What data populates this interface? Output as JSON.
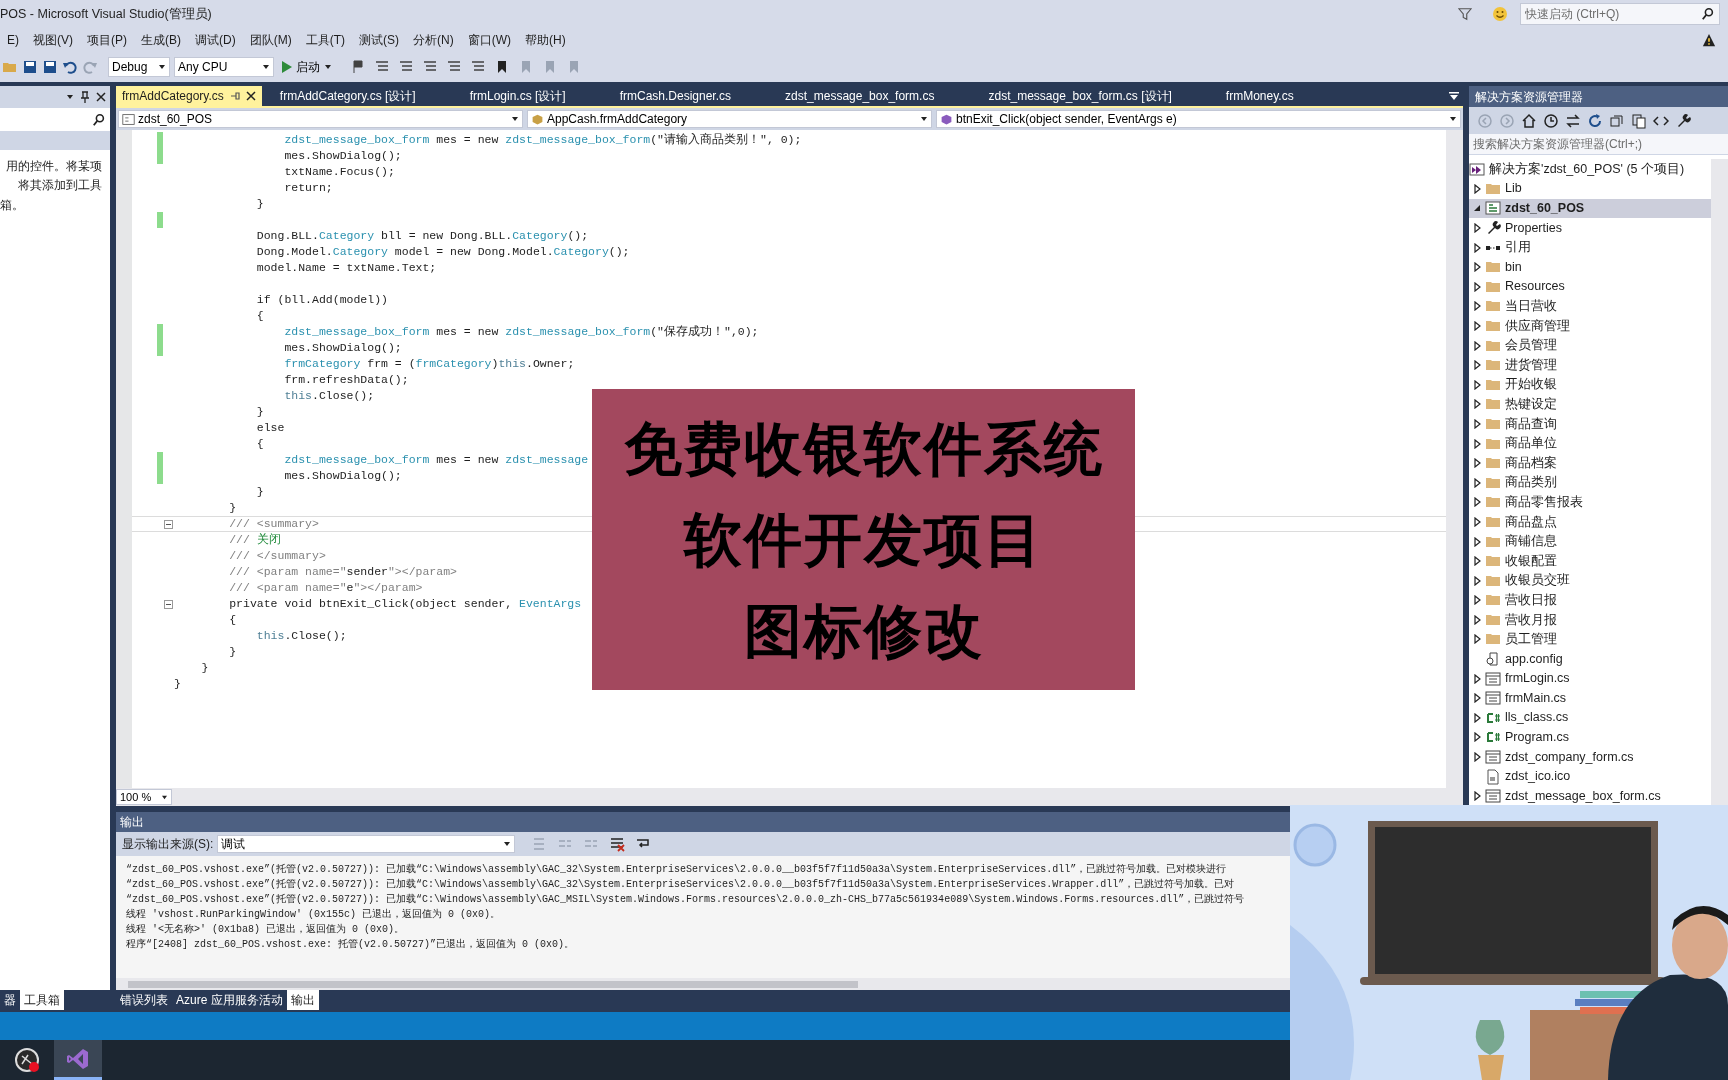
{
  "window": {
    "title": "POS - Microsoft Visual Studio(管理员)",
    "quick_launch": {
      "placeholder": "快速启动 (Ctrl+Q)"
    }
  },
  "menu": [
    "E)",
    "视图(V)",
    "项目(P)",
    "生成(B)",
    "调试(D)",
    "团队(M)",
    "工具(T)",
    "测试(S)",
    "分析(N)",
    "窗口(W)",
    "帮助(H)"
  ],
  "toolbar": {
    "configuration": "Debug",
    "platform": "Any CPU",
    "start": "启动"
  },
  "toolbox": {
    "lines": [
      "用的控件。将某项",
      "将其添加到工具",
      "箱。"
    ],
    "tabs": [
      {
        "label": "器",
        "selected": false
      },
      {
        "label": "工具箱",
        "selected": true
      }
    ]
  },
  "editor": {
    "tabs": [
      {
        "label": "frmAddCategory.cs",
        "selected": true
      },
      {
        "label": "frmAddCategory.cs [设计]",
        "selected": false
      },
      {
        "label": "frmLogin.cs [设计]",
        "selected": false
      },
      {
        "label": "frmCash.Designer.cs",
        "selected": false
      },
      {
        "label": "zdst_message_box_form.cs",
        "selected": false
      },
      {
        "label": "zdst_message_box_form.cs [设计]",
        "selected": false
      },
      {
        "label": "frmMoney.cs",
        "selected": false
      }
    ],
    "nav": [
      "zdst_60_POS",
      "AppCash.frmAddCategory",
      "btnExit_Click(object sender, EventArgs e)"
    ],
    "lines": [
      {
        "changed": true,
        "fold": false,
        "current": false,
        "spans": [
          {
            "kind": "type",
            "text": "                zdst_message_box_form"
          },
          {
            "kind": "text",
            "text": " mes = new "
          },
          {
            "kind": "type",
            "text": "zdst_message_box_form"
          },
          {
            "kind": "text",
            "text": "(\"请输入商品类别！\", 0);"
          }
        ]
      },
      {
        "changed": true,
        "fold": false,
        "current": false,
        "spans": [
          {
            "kind": "text",
            "text": "                mes.ShowDialog();"
          }
        ]
      },
      {
        "changed": false,
        "fold": false,
        "current": false,
        "spans": [
          {
            "kind": "text",
            "text": "                txtName.Focus();"
          }
        ]
      },
      {
        "changed": false,
        "fold": false,
        "current": false,
        "spans": [
          {
            "kind": "text",
            "text": "                return;"
          }
        ]
      },
      {
        "changed": false,
        "fold": false,
        "current": false,
        "spans": [
          {
            "kind": "text",
            "text": "            }"
          }
        ]
      },
      {
        "changed": true,
        "fold": false,
        "current": false
      },
      {
        "changed": false,
        "fold": false,
        "current": false,
        "spans": [
          {
            "kind": "text",
            "text": "            Dong.BLL."
          },
          {
            "kind": "type",
            "text": "Category"
          },
          {
            "kind": "text",
            "text": " bll = new Dong.BLL."
          },
          {
            "kind": "type",
            "text": "Category"
          },
          {
            "kind": "text",
            "text": "();"
          }
        ]
      },
      {
        "changed": false,
        "fold": false,
        "current": false,
        "spans": [
          {
            "kind": "text",
            "text": "            Dong.Model."
          },
          {
            "kind": "type",
            "text": "Category"
          },
          {
            "kind": "text",
            "text": " model = new Dong.Model."
          },
          {
            "kind": "type",
            "text": "Category"
          },
          {
            "kind": "text",
            "text": "();"
          }
        ]
      },
      {
        "changed": false,
        "fold": false,
        "current": false,
        "spans": [
          {
            "kind": "text",
            "text": "            model.Name = txtName.Text;"
          }
        ]
      },
      {
        "changed": false,
        "fold": false,
        "current": false
      },
      {
        "changed": false,
        "fold": false,
        "current": false,
        "spans": [
          {
            "kind": "text",
            "text": "            if (bll.Add(model))"
          }
        ]
      },
      {
        "changed": false,
        "fold": false,
        "current": false,
        "spans": [
          {
            "kind": "text",
            "text": "            {"
          }
        ]
      },
      {
        "changed": true,
        "fold": false,
        "current": false,
        "spans": [
          {
            "kind": "type",
            "text": "                zdst_message_box_form"
          },
          {
            "kind": "text",
            "text": " mes = new "
          },
          {
            "kind": "type",
            "text": "zdst_message_box_form"
          },
          {
            "kind": "text",
            "text": "(\"保存成功！\",0);"
          }
        ]
      },
      {
        "changed": true,
        "fold": false,
        "current": false,
        "spans": [
          {
            "kind": "text",
            "text": "                mes.ShowDialog();"
          }
        ]
      },
      {
        "changed": false,
        "fold": false,
        "current": false,
        "spans": [
          {
            "kind": "type",
            "text": "                frmCategory"
          },
          {
            "kind": "text",
            "text": " frm = ("
          },
          {
            "kind": "type",
            "text": "frmCategory"
          },
          {
            "kind": "text",
            "text": ")"
          },
          {
            "kind": "keyword",
            "text": "this"
          },
          {
            "kind": "text",
            "text": ".Owner;"
          }
        ]
      },
      {
        "changed": false,
        "fold": false,
        "current": false,
        "spans": [
          {
            "kind": "text",
            "text": "                frm.refreshData();"
          }
        ]
      },
      {
        "changed": false,
        "fold": false,
        "current": false,
        "spans": [
          {
            "kind": "keyword",
            "text": "                this"
          },
          {
            "kind": "text",
            "text": ".Close();"
          }
        ]
      },
      {
        "changed": false,
        "fold": false,
        "current": false,
        "spans": [
          {
            "kind": "text",
            "text": "            }"
          }
        ]
      },
      {
        "changed": false,
        "fold": false,
        "current": false,
        "spans": [
          {
            "kind": "text",
            "text": "            else"
          }
        ]
      },
      {
        "changed": false,
        "fold": false,
        "current": false,
        "spans": [
          {
            "kind": "text",
            "text": "            {"
          }
        ]
      },
      {
        "changed": true,
        "fold": false,
        "current": false,
        "spans": [
          {
            "kind": "type",
            "text": "                zdst_message_box_form"
          },
          {
            "kind": "text",
            "text": " mes = new "
          },
          {
            "kind": "type",
            "text": "zdst_message"
          }
        ]
      },
      {
        "changed": true,
        "fold": false,
        "current": false,
        "spans": [
          {
            "kind": "text",
            "text": "                mes.ShowDialog();"
          }
        ]
      },
      {
        "changed": false,
        "fold": false,
        "current": false,
        "spans": [
          {
            "kind": "text",
            "text": "            }"
          }
        ]
      },
      {
        "changed": false,
        "fold": false,
        "current": false,
        "spans": [
          {
            "kind": "text",
            "text": "        }"
          }
        ]
      },
      {
        "changed": false,
        "fold": true,
        "current": true,
        "spans": [
          {
            "kind": "comment",
            "text": "        /// <summary>"
          }
        ]
      },
      {
        "changed": false,
        "fold": false,
        "current": false,
        "spans": [
          {
            "kind": "comment",
            "text": "        /// "
          },
          {
            "kind": "doc",
            "text": "关闭"
          }
        ]
      },
      {
        "changed": false,
        "fold": false,
        "current": false,
        "spans": [
          {
            "kind": "comment",
            "text": "        /// </summary>"
          }
        ]
      },
      {
        "changed": false,
        "fold": false,
        "current": false,
        "spans": [
          {
            "kind": "comment",
            "text": "        /// <param name=\""
          },
          {
            "kind": "text",
            "text": "sender"
          },
          {
            "kind": "comment",
            "text": "\"></param>"
          }
        ]
      },
      {
        "changed": false,
        "fold": false,
        "current": false,
        "spans": [
          {
            "kind": "comment",
            "text": "        /// <param name=\""
          },
          {
            "kind": "text",
            "text": "e"
          },
          {
            "kind": "comment",
            "text": "\"></param>"
          }
        ]
      },
      {
        "changed": false,
        "fold": true,
        "current": false,
        "spans": [
          {
            "kind": "text",
            "text": "        private void btnExit_Click(object sender, "
          },
          {
            "kind": "type",
            "text": "EventArgs"
          }
        ]
      },
      {
        "changed": false,
        "fold": false,
        "current": false,
        "spans": [
          {
            "kind": "text",
            "text": "        {"
          }
        ]
      },
      {
        "changed": false,
        "fold": false,
        "current": false,
        "spans": [
          {
            "kind": "keyword",
            "text": "            this"
          },
          {
            "kind": "text",
            "text": ".Close();"
          }
        ]
      },
      {
        "changed": false,
        "fold": false,
        "current": false,
        "spans": [
          {
            "kind": "text",
            "text": "        }"
          }
        ]
      },
      {
        "changed": false,
        "fold": false,
        "current": false,
        "spans": [
          {
            "kind": "text",
            "text": "    }"
          }
        ]
      },
      {
        "changed": false,
        "fold": false,
        "current": false,
        "spans": [
          {
            "kind": "text",
            "text": "}"
          }
        ]
      }
    ],
    "zoom": "100 %"
  },
  "solution_explorer": {
    "title": "解决方案资源管理器",
    "search": {
      "placeholder": "搜索解决方案资源管理器(Ctrl+;)"
    },
    "tree": [
      {
        "label": "解决方案'zdst_60_POS' (5 个项目)",
        "kind": "solution",
        "selected": false,
        "children": [
          {
            "label": "Lib",
            "kind": "folder",
            "expanded": false,
            "selected": false
          },
          {
            "label": "zdst_60_POS",
            "kind": "project",
            "expanded": true,
            "selected": true,
            "children": [
              {
                "label": "Properties",
                "kind": "wrench",
                "expanded": false,
                "selected": false
              },
              {
                "label": "引用",
                "kind": "references",
                "expanded": false,
                "selected": false
              },
              {
                "label": "bin",
                "kind": "folder",
                "expanded": false,
                "selected": false
              },
              {
                "label": "Resources",
                "kind": "folder",
                "expanded": false,
                "selected": false
              },
              {
                "label": "当日营收",
                "kind": "folder",
                "expanded": false,
                "selected": false
              },
              {
                "label": "供应商管理",
                "kind": "folder",
                "expanded": false,
                "selected": false
              },
              {
                "label": "会员管理",
                "kind": "folder",
                "expanded": false,
                "selected": false
              },
              {
                "label": "进货管理",
                "kind": "folder",
                "expanded": false,
                "selected": false
              },
              {
                "label": "开始收银",
                "kind": "folder",
                "expanded": false,
                "selected": false
              },
              {
                "label": "热键设定",
                "kind": "folder",
                "expanded": false,
                "selected": false
              },
              {
                "label": "商品查询",
                "kind": "folder",
                "expanded": false,
                "selected": false
              },
              {
                "label": "商品单位",
                "kind": "folder",
                "expanded": false,
                "selected": false
              },
              {
                "label": "商品档案",
                "kind": "folder",
                "expanded": false,
                "selected": false
              },
              {
                "label": "商品类别",
                "kind": "folder",
                "expanded": false,
                "selected": false
              },
              {
                "label": "商品零售报表",
                "kind": "folder",
                "expanded": false,
                "selected": false
              },
              {
                "label": "商品盘点",
                "kind": "folder",
                "expanded": false,
                "selected": false
              },
              {
                "label": "商铺信息",
                "kind": "folder",
                "expanded": false,
                "selected": false
              },
              {
                "label": "收银配置",
                "kind": "folder",
                "expanded": false,
                "selected": false
              },
              {
                "label": "收银员交班",
                "kind": "folder",
                "expanded": false,
                "selected": false
              },
              {
                "label": "营收日报",
                "kind": "folder",
                "expanded": false,
                "selected": false
              },
              {
                "label": "营收月报",
                "kind": "folder",
                "expanded": false,
                "selected": false
              },
              {
                "label": "员工管理",
                "kind": "folder",
                "expanded": false,
                "selected": false
              },
              {
                "label": "app.config",
                "kind": "config",
                "selected": false
              },
              {
                "label": "frmLogin.cs",
                "kind": "form",
                "expanded": false,
                "selected": false
              },
              {
                "label": "frmMain.cs",
                "kind": "form",
                "expanded": false,
                "selected": false
              },
              {
                "label": "lls_class.cs",
                "kind": "csharp",
                "expanded": false,
                "selected": false
              },
              {
                "label": "Program.cs",
                "kind": "csharp",
                "expanded": false,
                "selected": false
              },
              {
                "label": "zdst_company_form.cs",
                "kind": "form",
                "expanded": false,
                "selected": false
              },
              {
                "label": "zdst_ico.ico",
                "kind": "ico",
                "selected": false
              },
              {
                "label": "zdst_message_box_form.cs",
                "kind": "form",
                "expanded": false,
                "selected": false
              }
            ]
          }
        ]
      }
    ]
  },
  "output": {
    "title": "输出",
    "source_label": "显示输出来源(S):",
    "source": "调试",
    "lines": [
      "“zdst_60_POS.vshost.exe”(托管(v2.0.50727)): 已加载“C:\\Windows\\assembly\\GAC_32\\System.EnterpriseServices\\2.0.0.0__b03f5f7f11d50a3a\\System.EnterpriseServices.dll”，已跳过符号加载。已对模块进行",
      "“zdst_60_POS.vshost.exe”(托管(v2.0.50727)): 已加载“C:\\Windows\\assembly\\GAC_32\\System.EnterpriseServices\\2.0.0.0__b03f5f7f11d50a3a\\System.EnterpriseServices.Wrapper.dll”，已跳过符号加载。已对",
      "“zdst_60_POS.vshost.exe”(托管(v2.0.50727)): 已加载“C:\\Windows\\assembly\\GAC_MSIL\\System.Windows.Forms.resources\\2.0.0.0_zh-CHS_b77a5c561934e089\\System.Windows.Forms.resources.dll”，已跳过符号",
      "线程 'vshost.RunParkingWindow' (0x155c) 已退出，返回值为 0 (0x0)。",
      "线程 '<无名称>' (0x1ba8) 已退出，返回值为 0 (0x0)。",
      "程序“[2408] zdst_60_POS.vshost.exe: 托管(v2.0.50727)”已退出，返回值为 0 (0x0)。"
    ],
    "tabs": [
      {
        "label": "错误列表",
        "selected": false
      },
      {
        "label": "Azure 应用服务活动",
        "selected": false
      },
      {
        "label": "输出",
        "selected": true
      }
    ]
  },
  "overlay_banner": {
    "lines": [
      "免费收银软件系统",
      "软件开发项目",
      "图标修改"
    ]
  }
}
